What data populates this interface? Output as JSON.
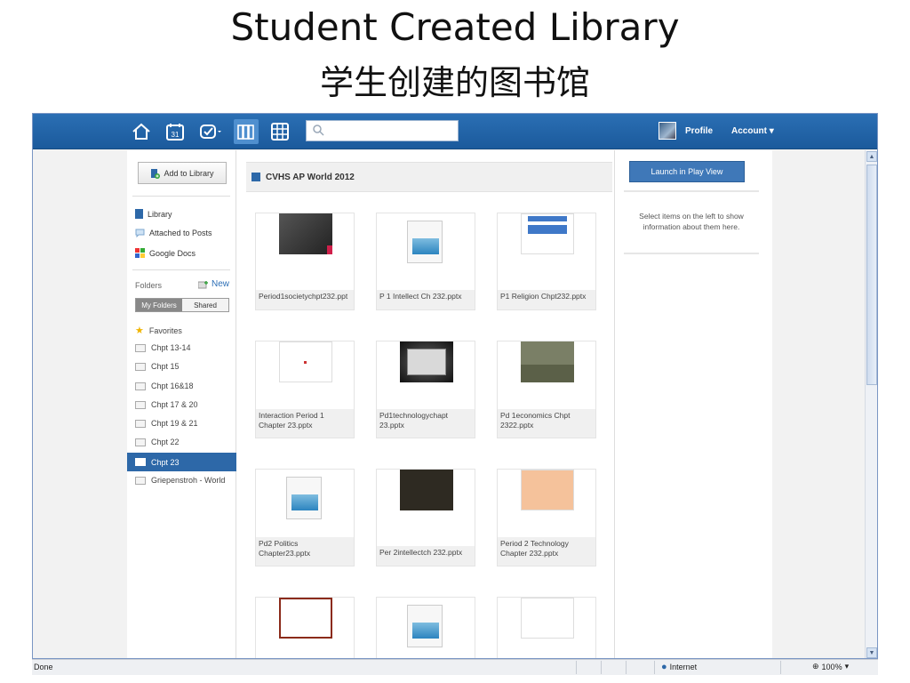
{
  "slide": {
    "title": "Student Created Library",
    "subtitle": "学生创建的图书馆"
  },
  "topbar": {
    "nav_icons": [
      "home-icon",
      "calendar-icon",
      "check-icon",
      "library-icon",
      "grid-icon"
    ],
    "calendar_day": "31",
    "search_placeholder": "",
    "profile_label": "Profile",
    "account_label": "Account ▾"
  },
  "sidebar": {
    "add_button": "Add to Library",
    "nav": [
      {
        "label": "Library",
        "icon": "book-icon"
      },
      {
        "label": "Attached to Posts",
        "icon": "comment-icon"
      },
      {
        "label": "Google Docs",
        "icon": "google-docs-icon"
      }
    ],
    "folders_label": "Folders",
    "new_label": "New",
    "tabs": [
      "My Folders",
      "Shared"
    ],
    "favorites_label": "Favorites",
    "folders": [
      "Chpt 13-14",
      "Chpt 15",
      "Chpt 16&18",
      "Chpt 17 & 20",
      "Chpt 19 & 21",
      "Chpt 22"
    ],
    "selected_folder": "Chpt 23",
    "after_folders": [
      "Griepenstroh - World"
    ]
  },
  "main": {
    "folder_title": "CVHS AP World 2012",
    "items": [
      {
        "caption": "Period1societychpt232.ppt",
        "thumb": "dark-slide"
      },
      {
        "caption": "P 1 Intellect Ch 232.pptx",
        "thumb": "generic-file"
      },
      {
        "caption": "P1 Religion Chpt232.pptx",
        "thumb": "blue-boxes-slide"
      },
      {
        "caption": "Interaction Period 1 Chapter 23.pptx",
        "thumb": "white-slide"
      },
      {
        "caption": "Pd1technologychapt 23.pptx",
        "thumb": "chalkboard-slide"
      },
      {
        "caption": "Pd 1economics Chpt 2322.pptx",
        "thumb": "green-slide"
      },
      {
        "caption": "Pd2 Politics Chapter23.pptx",
        "thumb": "generic-file"
      },
      {
        "caption": "Per 2intellectch 232.pptx",
        "thumb": "brown-slide"
      },
      {
        "caption": "Period 2 Technology Chapter 232.pptx",
        "thumb": "orange-slide"
      },
      {
        "caption": "",
        "thumb": "red-border-slide"
      },
      {
        "caption": "",
        "thumb": "generic-file"
      },
      {
        "caption": "",
        "thumb": "white-slide-2"
      }
    ]
  },
  "right": {
    "launch_button": "Launch in Play View",
    "info_text": "Select items on the left to show information about them here."
  },
  "statusbar": {
    "status": "Done",
    "zone": "Internet",
    "zoom": "100%"
  }
}
